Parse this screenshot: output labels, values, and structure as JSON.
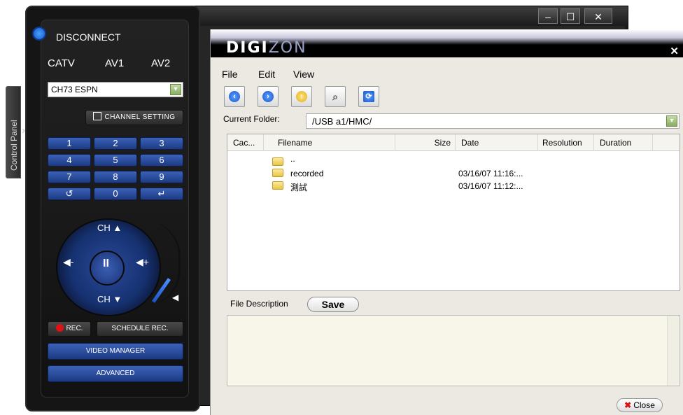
{
  "background_window": {
    "controls": {
      "minimize": "–",
      "maximize": "☐",
      "close": "✕"
    }
  },
  "control_panel_tab": {
    "label": "Control Panel",
    "arrow": "›"
  },
  "remote": {
    "disconnect_label": "DISCONNECT",
    "sources": [
      "CATV",
      "AV1",
      "AV2"
    ],
    "channel_select": {
      "value": "CH73 ESPN",
      "arrow": "▾"
    },
    "channel_setting_label": "CHANNEL SETTING",
    "keypad": [
      "1",
      "2",
      "3",
      "4",
      "5",
      "6",
      "7",
      "8",
      "9",
      "↺",
      "0",
      "↵"
    ],
    "ch_up_label": "CH ▲",
    "ch_down_label": "CH ▼",
    "vol_down_label": "◀-",
    "vol_up_label": "◀+",
    "pause_label": "II",
    "mute_label": "◀",
    "rec_label": "REC.",
    "schedule_rec_label": "SCHEDULE REC.",
    "video_manager_label": "VIDEO MANAGER",
    "advanced_label": "ADVANCED"
  },
  "file_browser": {
    "brand_bold": "DIGI",
    "brand_light": "ZON",
    "close_glyph": "✕",
    "menu": [
      "File",
      "Edit",
      "View"
    ],
    "toolbar_icons": [
      "back-icon",
      "forward-icon",
      "up-folder-icon",
      "search-icon",
      "refresh-icon"
    ],
    "toolbar_glyphs": {
      "back": "‹",
      "forward": "›",
      "up": "↑",
      "search": "⌕",
      "refresh": "⟳"
    },
    "current_folder_label": "Current Folder:",
    "current_folder_value": "/USB a1/HMC/",
    "folder_dd_arrow": "▾",
    "columns": [
      "Cac...",
      "Filename",
      "Size",
      "Date",
      "Resolution",
      "Duration"
    ],
    "rows": [
      {
        "name": "..",
        "date": ""
      },
      {
        "name": "recorded",
        "date": "03/16/07 11:16:..."
      },
      {
        "name": "測試",
        "date": "03/16/07 11:12:..."
      }
    ],
    "file_description_label": "File Description",
    "save_label": "Save",
    "close_label": "Close",
    "close_x": "✖"
  },
  "colors": {
    "accent_blue": "#1d3a82",
    "rec_red": "#e21010",
    "folder_yellow": "#e7c54a"
  }
}
